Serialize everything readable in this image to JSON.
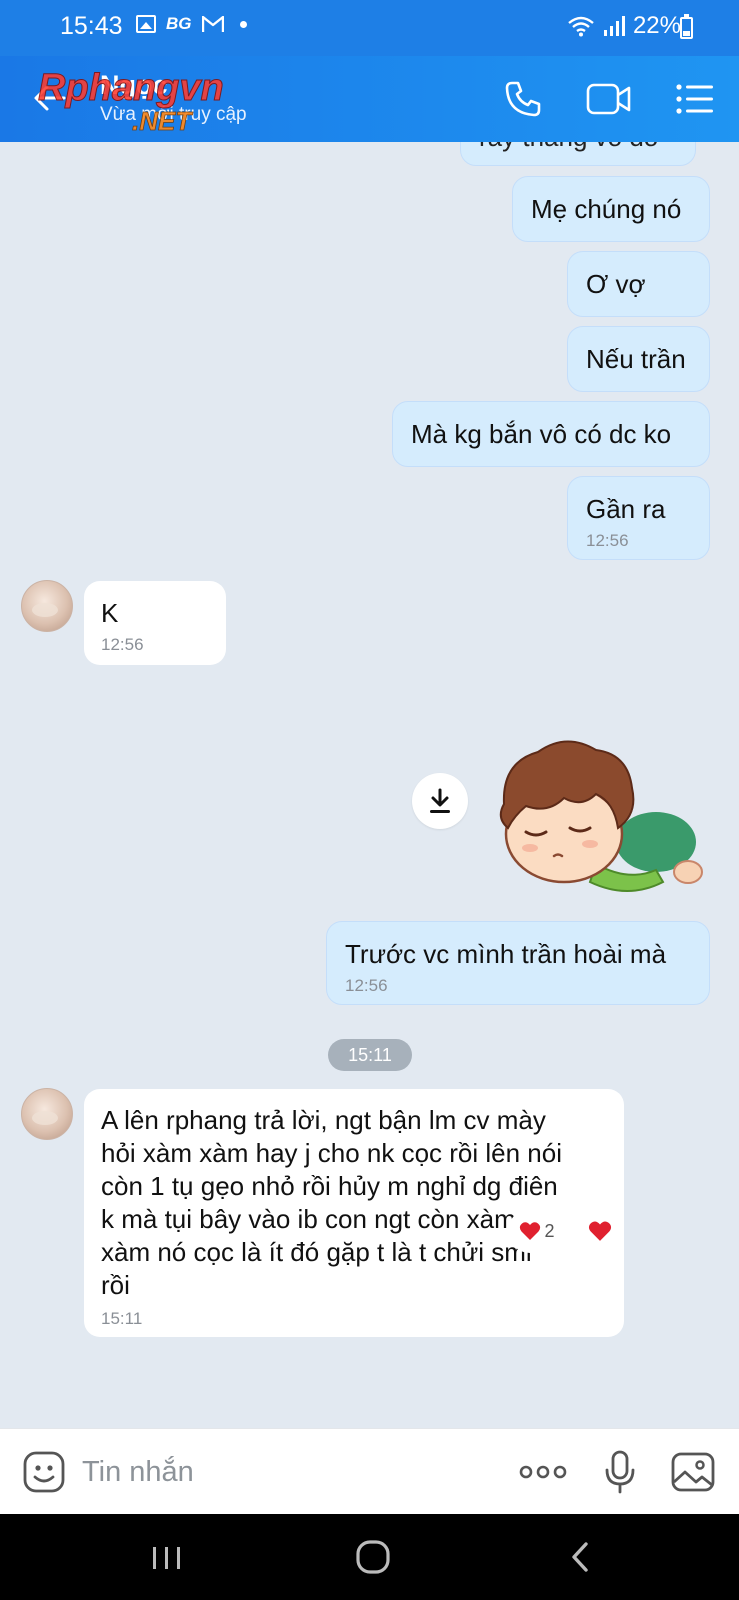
{
  "status_bar": {
    "time": "15:43",
    "carrier_tag": "BG",
    "battery": "22%"
  },
  "header": {
    "contact_name": "Ngọc",
    "status": "Vừa mới truy cập",
    "watermark_top": "Rphangvn",
    "watermark_bottom": ".NET"
  },
  "messages": {
    "out_partial": "rầy thằng vô đó",
    "out_1": "Mẹ chúng nó",
    "out_2": "Ơ vợ",
    "out_3": "Nếu trần",
    "out_4": "Mà kg bắn vô có dc ko",
    "out_5": {
      "text": "Gần ra",
      "time": "12:56"
    },
    "in_1": {
      "text": "K",
      "time": "12:56"
    },
    "out_6": {
      "text": "Trước vc mình trần hoài mà",
      "time": "12:56"
    },
    "date_divider": "15:11",
    "in_2": {
      "text": "A lên rphang trả lời, ngt bận lm cv mày\nhỏi xàm xàm hay j cho nk cọc rồi lên nói\ncòn 1 tụ gẹo nhỏ rồi hủy m nghỉ dg điên\nk mà tụi bây vào ib con ngt còn xàm\nxàm nó cọc là ít đó gặp t là t chửi sml\nrồi",
      "time": "15:11"
    },
    "reaction_count": "2"
  },
  "input": {
    "placeholder": "Tin nhắn"
  },
  "colors": {
    "header_blue": "#1a78e6",
    "outgoing_bubble": "#d5ecfd",
    "incoming_bubble": "#ffffff",
    "chat_background": "#e2e9f1",
    "heart": "#e0202f"
  },
  "icons": {
    "back": "arrow-left",
    "call": "phone",
    "video": "video-camera",
    "menu": "list",
    "download": "download-arrow",
    "emoji": "smiley",
    "more": "three-dots",
    "mic": "microphone",
    "gallery": "image"
  }
}
